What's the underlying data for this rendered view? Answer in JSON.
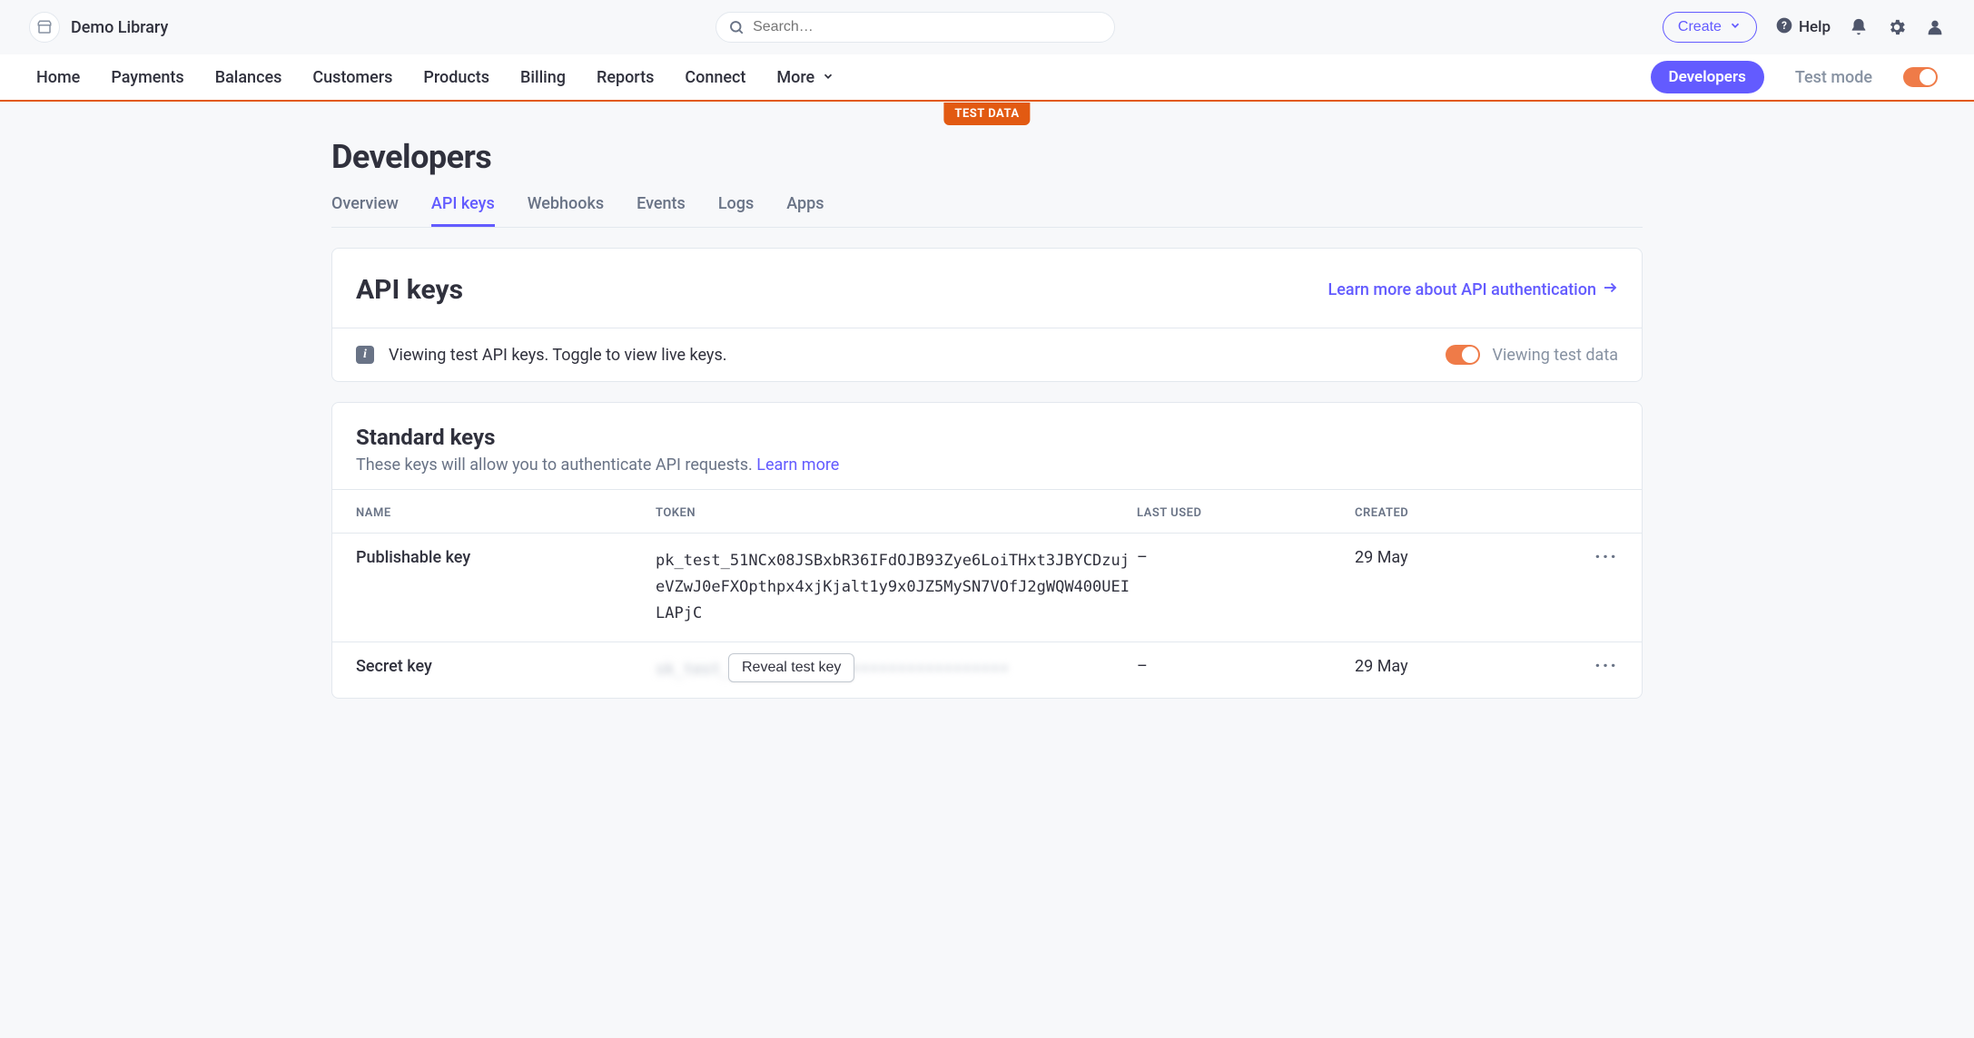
{
  "header": {
    "org_name": "Demo Library",
    "search_placeholder": "Search…",
    "create_label": "Create",
    "help_label": "Help"
  },
  "nav": {
    "items": [
      "Home",
      "Payments",
      "Balances",
      "Customers",
      "Products",
      "Billing",
      "Reports",
      "Connect",
      "More"
    ],
    "developers_label": "Developers",
    "test_mode_label": "Test mode",
    "test_data_tag": "TEST DATA"
  },
  "page": {
    "title": "Developers"
  },
  "subtabs": {
    "items": [
      "Overview",
      "API keys",
      "Webhooks",
      "Events",
      "Logs",
      "Apps"
    ],
    "active_index": 1
  },
  "api_keys_panel": {
    "title": "API keys",
    "learn_link": "Learn more about API authentication",
    "info_text": "Viewing test API keys. Toggle to view live keys.",
    "viewing_test_label": "Viewing test data"
  },
  "standard_keys": {
    "title": "Standard keys",
    "subtitle": "These keys will allow you to authenticate API requests. ",
    "learn_more": "Learn more",
    "columns": [
      "NAME",
      "TOKEN",
      "LAST USED",
      "CREATED"
    ],
    "rows": [
      {
        "name": "Publishable key",
        "token": "pk_test_51NCx08JSBxbR36IFdOJB93Zye6LoiTHxt3JBYCDzujeVZwJ0eFXOpthpx4xjKjalt1y9x0JZ5MySN7VOfJ2gWQW400UEILAPjC",
        "last_used": "–",
        "created": "29 May"
      },
      {
        "name": "Secret key",
        "token_hidden": "sk_test_••••••••••••••••••••••••••••••",
        "reveal_label": "Reveal test key",
        "last_used": "–",
        "created": "29 May"
      }
    ]
  }
}
